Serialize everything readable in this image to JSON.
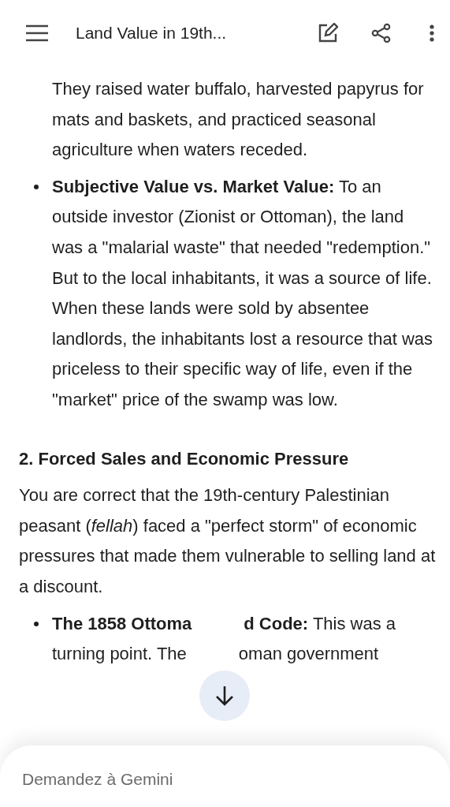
{
  "header": {
    "title": "Land Value in 19th..."
  },
  "blocks": [
    {
      "kind": "bullet_cont",
      "text": "They raised water buffalo, harvested papyrus for mats and baskets, and practiced seasonal agriculture when waters receded."
    },
    {
      "kind": "bullet",
      "text": "**Subjective Value vs. Market Value:** To an outside investor (Zionist or Ottoman), the land was a \"malarial waste\" that needed \"redemption.\" But to the local inhabitants, it was a source of life. When these lands were sold by absentee landlords, the inhabitants lost a resource that was priceless to their specific way of life, even if the \"market\" price of the swamp was low."
    },
    {
      "kind": "heading",
      "text": "2. Forced Sales and Economic Pressure"
    },
    {
      "kind": "paragraph",
      "text": "You are correct that the 19th-century Palestinian peasant (*fellah*) faced a \"perfect storm\" of economic pressures that made them vulnerable to selling land at a discount."
    },
    {
      "kind": "bullet_covered",
      "lines": [
        [
          "**The 1858 Ottoma**",
          "**d Code:** This was a"
        ],
        [
          "turning point. The",
          "oman government"
        ]
      ]
    }
  ],
  "input": {
    "placeholder": "Demandez à Gemini"
  }
}
